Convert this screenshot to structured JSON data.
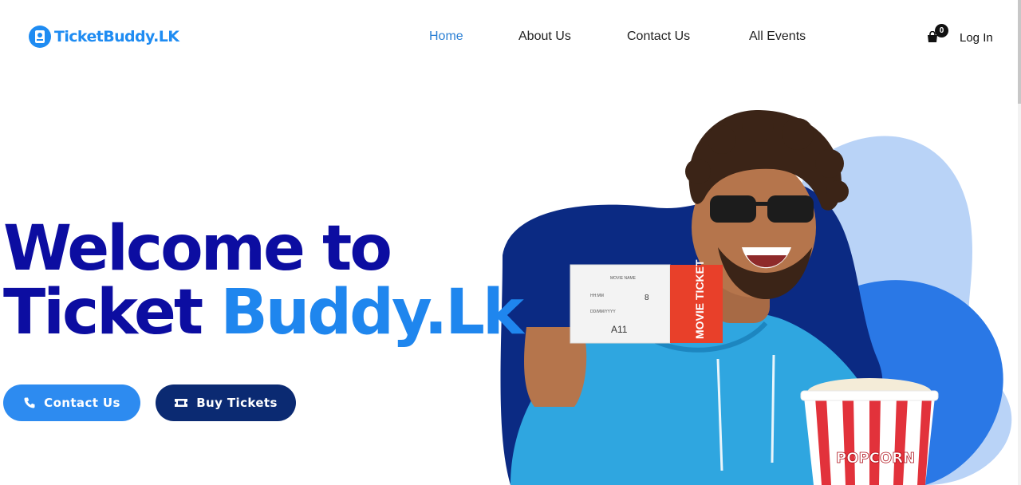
{
  "brand": {
    "name": "TicketBuddy.LK"
  },
  "nav": {
    "items": [
      {
        "label": "Home",
        "active": true
      },
      {
        "label": "About Us",
        "active": false
      },
      {
        "label": "Contact Us",
        "active": false
      },
      {
        "label": "All Events",
        "active": false
      }
    ]
  },
  "cart": {
    "count": "0",
    "icon": "cart-icon"
  },
  "auth": {
    "login_label": "Log In"
  },
  "hero": {
    "title_line1": "Welcome to",
    "title_line2_part1": "Ticket ",
    "title_line2_accent": "Buddy.Lk",
    "ticket_text": "MOVIE TICKET",
    "seat": "A11",
    "popcorn_text": "POPCORN"
  },
  "buttons": {
    "contact": {
      "label": "Contact Us",
      "icon": "phone-icon"
    },
    "buy": {
      "label": "Buy Tickets",
      "icon": "ticket-icon"
    }
  },
  "colors": {
    "brand_blue": "#1f8cf2",
    "title_navy": "#0c0da1",
    "accent_blue": "#1f86ee",
    "contact_btn": "#2d8bf0",
    "buy_btn": "#0b2a72"
  }
}
